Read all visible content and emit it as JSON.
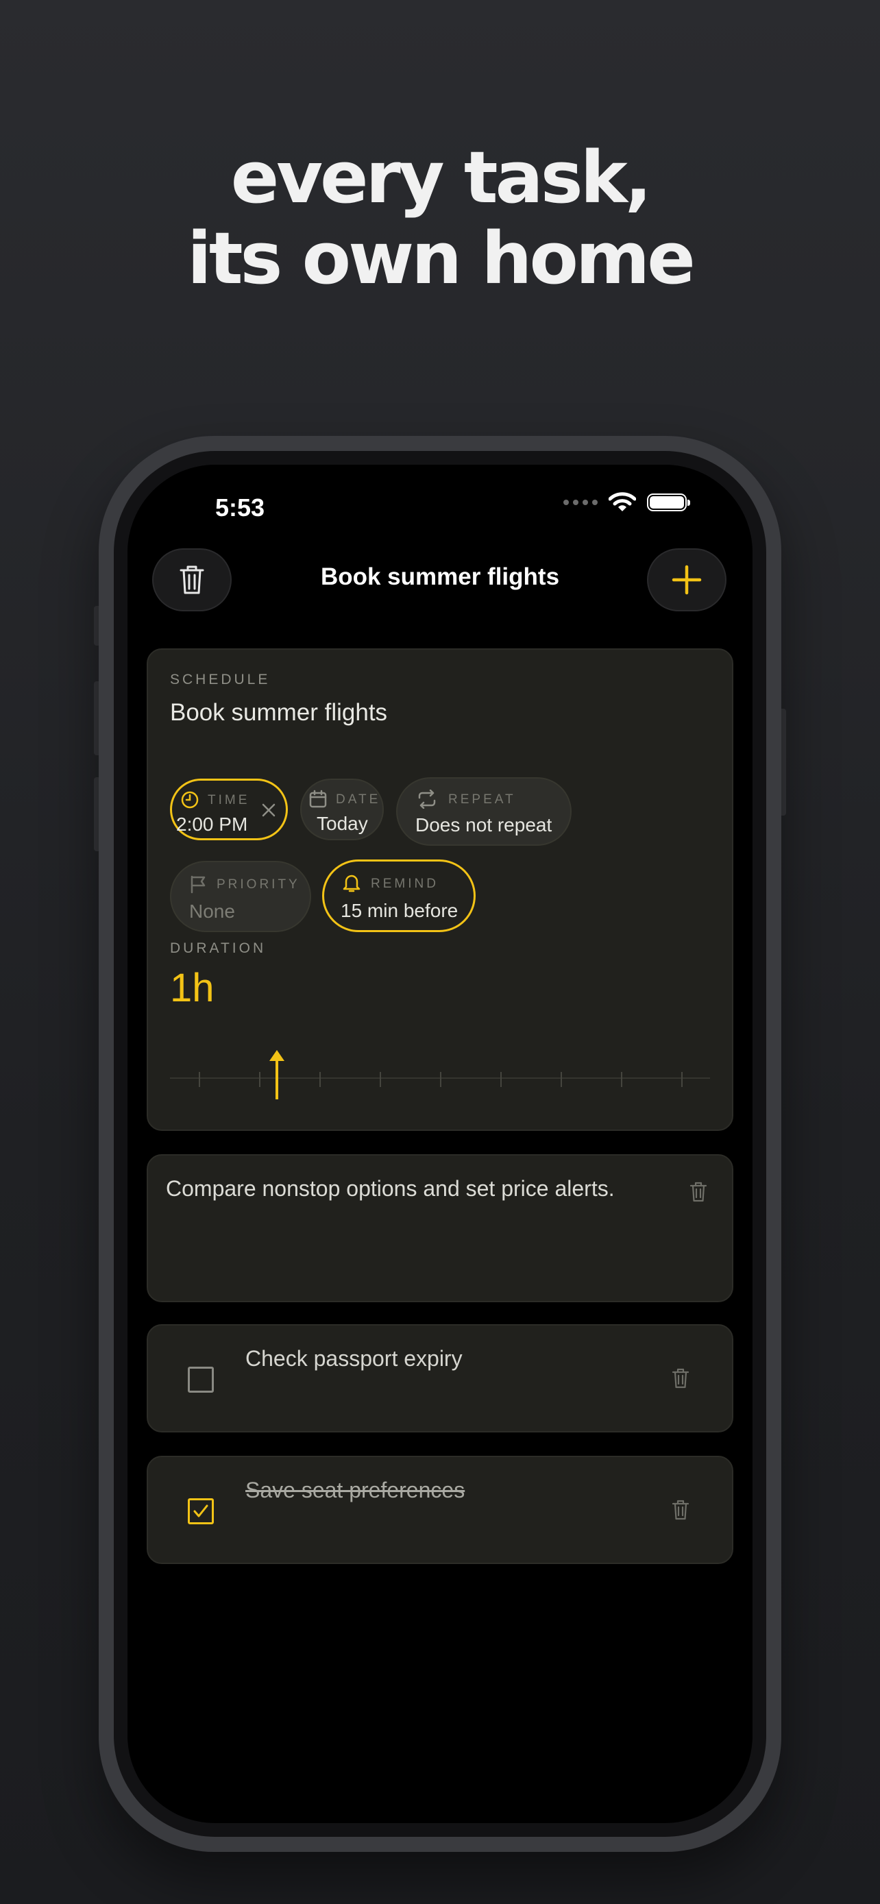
{
  "headline": {
    "line1": "every task,",
    "line2": "its own home"
  },
  "status_bar": {
    "time": "5:53"
  },
  "nav": {
    "title": "Book summer flights"
  },
  "schedule": {
    "section_label": "SCHEDULE",
    "title": "Book summer flights",
    "chips": {
      "time": {
        "caption": "TIME",
        "value": "2:00 PM"
      },
      "date": {
        "caption": "DATE",
        "value": "Today"
      },
      "repeat": {
        "caption": "REPEAT",
        "value": "Does not repeat"
      },
      "priority": {
        "caption": "PRIORITY",
        "value": "None"
      },
      "remind": {
        "caption": "REMIND",
        "value": "15 min before"
      }
    },
    "duration_label": "DURATION",
    "duration_value": "1h"
  },
  "note": {
    "text": "Compare nonstop options and set price alerts."
  },
  "subtasks": [
    {
      "label": "Check passport expiry",
      "done": false
    },
    {
      "label": "Save seat preferences",
      "done": true
    }
  ],
  "colors": {
    "accent": "#f3c316",
    "card": "#21211d",
    "background": "#000000"
  },
  "icons": [
    "trash-icon",
    "plus-icon",
    "clock-icon",
    "close-icon",
    "calendar-icon",
    "repeat-icon",
    "flag-icon",
    "bell-icon",
    "checkmark-icon",
    "wifi-icon",
    "battery-icon"
  ]
}
